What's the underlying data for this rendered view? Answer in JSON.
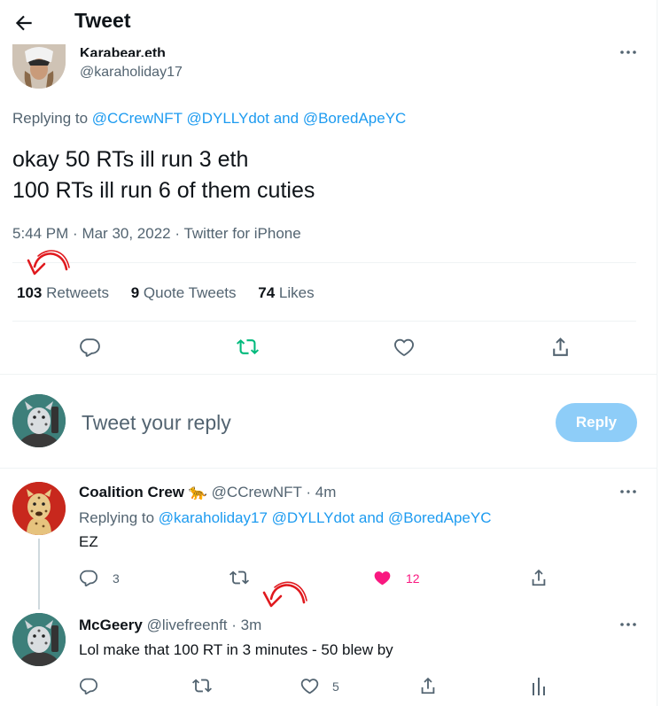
{
  "header": {
    "title": "Tweet"
  },
  "tweet": {
    "author_name": "Karabear.eth",
    "author_handle": "@karaholiday17",
    "replying_prefix": "Replying to",
    "replying_users": [
      "@CCrewNFT",
      "@DYLLYdot",
      "@BoredApeYC"
    ],
    "replying_joiner": "and",
    "text_line1": "okay 50 RTs ill run 3 eth",
    "text_line2": "100 RTs ill run 6 of them cuties",
    "time": "5:44 PM",
    "date": "Mar 30, 2022",
    "source": "Twitter for iPhone",
    "retweets_count": "103",
    "retweets_label": "Retweets",
    "quotes_count": "9",
    "quotes_label": "Quote Tweets",
    "likes_count": "74",
    "likes_label": "Likes"
  },
  "composer": {
    "placeholder": "Tweet your reply",
    "button_label": "Reply"
  },
  "replies": [
    {
      "name": "Coalition Crew",
      "badge": "🐆",
      "handle": "@CCrewNFT",
      "time": "4m",
      "replying_prefix": "Replying to",
      "replying_users": [
        "@karaholiday17",
        "@DYLLYdot",
        "@BoredApeYC"
      ],
      "replying_joiner": "and",
      "text": "EZ",
      "reply_count": "3",
      "retweet_count": "",
      "like_count": "12"
    },
    {
      "name": "McGeery",
      "handle": "@livefreenft",
      "time": "3m",
      "text": "Lol make that 100 RT in 3 minutes - 50 blew by",
      "reply_count": "",
      "retweet_count": "",
      "like_count": "5"
    }
  ],
  "colors": {
    "accent": "#1d9bf0",
    "retweet_green": "#00ba7c",
    "like_pink": "#f91880",
    "reply_button": "#8ecdf8",
    "annotation_red": "#e0191e"
  },
  "icons": [
    "back-arrow-icon",
    "more-icon",
    "reply-icon",
    "retweet-icon",
    "like-icon",
    "share-icon",
    "analytics-icon"
  ]
}
